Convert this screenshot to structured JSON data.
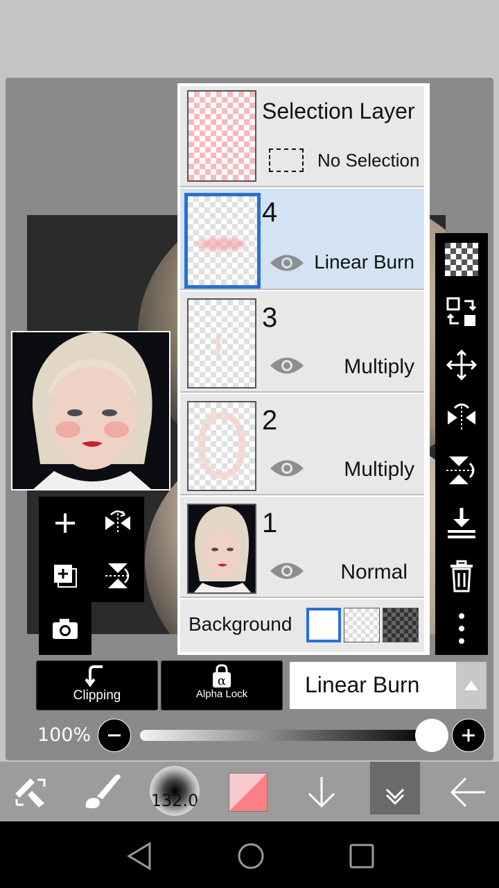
{
  "layers_panel": {
    "selection_layer": {
      "title": "Selection Layer",
      "status": "No Selection"
    },
    "layers": [
      {
        "number": "4",
        "blend": "Linear Burn",
        "selected": true
      },
      {
        "number": "3",
        "blend": "Multiply",
        "selected": false
      },
      {
        "number": "2",
        "blend": "Multiply",
        "selected": false
      },
      {
        "number": "1",
        "blend": "Normal",
        "selected": false
      }
    ],
    "background_label": "Background"
  },
  "controls": {
    "clipping_label": "Clipping",
    "alpha_lock_label": "Alpha Lock",
    "blend_mode_value": "Linear Burn",
    "opacity_label": "100%",
    "opacity_value": 1.0
  },
  "bottom_toolbar": {
    "brush_size": "132.0",
    "primary_color": "#ff7f86",
    "secondary_color": "#f6c9cc"
  },
  "colors": {
    "accent": "#2a6fd6",
    "selected_row": "#d4e3f3"
  },
  "icons": {
    "right_toolbar": [
      "checker-icon",
      "transform-swap-icon",
      "move-icon",
      "flip-horizontal-icon",
      "flip-vertical-icon",
      "merge-down-icon",
      "trash-icon",
      "more-icon"
    ],
    "left_tools": [
      "add-layer-icon",
      "flip-layer-horizontal-icon",
      "add-canvas-layer-icon",
      "flip-layer-vertical-icon",
      "camera-icon"
    ]
  }
}
